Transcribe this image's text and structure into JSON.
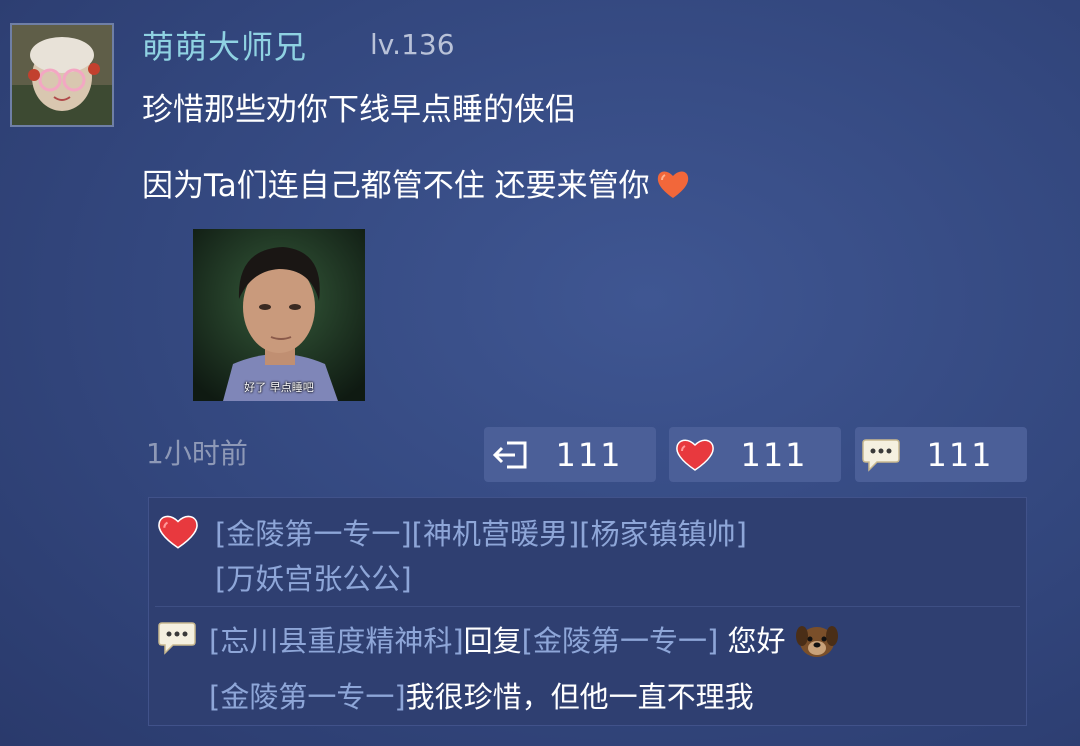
{
  "post": {
    "username": "萌萌大师兄",
    "level": "lv.136",
    "line1": "珍惜那些劝你下线早点睡的侠侣",
    "line2": "因为Ta们连自己都管不住 还要来管你",
    "meme_caption": "好了 早点睡吧",
    "time": "1小时前"
  },
  "actions": {
    "share_count": "111",
    "like_count": "111",
    "comment_count": "111"
  },
  "likes": {
    "names": [
      "[金陵第一专一]",
      "[神机营暖男]",
      "[杨家镇镇帅]",
      "[万妖宫张公公]"
    ]
  },
  "comments": [
    {
      "author": "[忘川县重度精神科]",
      "verb": "回复",
      "target": "[金陵第一专一]",
      "text": "您好"
    },
    {
      "author": "[金陵第一专一]",
      "text": "我很珍惜，但他一直不理我"
    }
  ],
  "icons": {
    "heart": "heart-icon",
    "share": "share-icon",
    "comment": "comment-icon",
    "dog_emoji": "dog-emoji-icon"
  },
  "colors": {
    "background": "#33477e",
    "username": "#8fd2e2",
    "name_link": "#8ea6d8",
    "heart": "#e8393e",
    "button": "#4b5f98"
  }
}
